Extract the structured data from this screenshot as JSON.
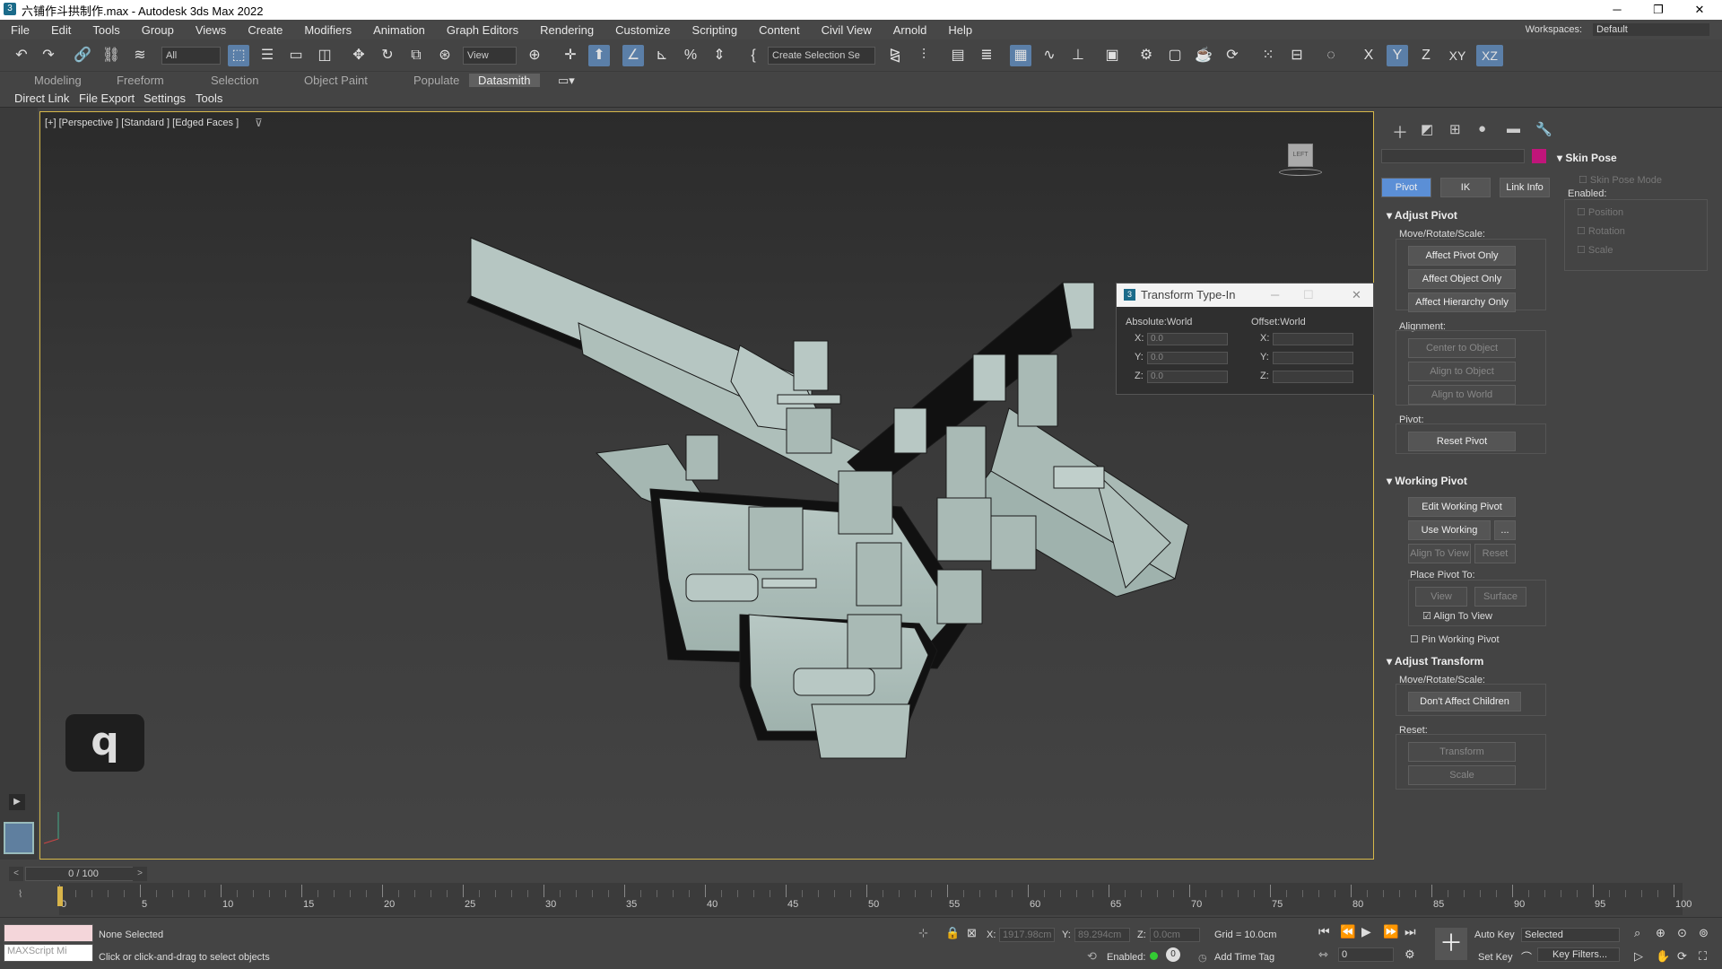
{
  "window": {
    "title": "六铺作斗拱制作.max - Autodesk 3ds Max 2022",
    "icon": "3ds-max-app-icon"
  },
  "menu": [
    "File",
    "Edit",
    "Tools",
    "Group",
    "Views",
    "Create",
    "Modifiers",
    "Animation",
    "Graph Editors",
    "Rendering",
    "Customize",
    "Scripting",
    "Content",
    "Civil View",
    "Arnold",
    "Help"
  ],
  "workspaces": {
    "label": "Workspaces:",
    "value": "Default"
  },
  "toolbar": {
    "filter": "All",
    "coord": "View",
    "selection_set": "Create Selection Se",
    "axis_labels": [
      "X",
      "Y",
      "Z",
      "XY",
      "XZ"
    ]
  },
  "ribbon": {
    "tabs": [
      "Modeling",
      "Freeform",
      "Selection",
      "Object Paint",
      "Populate",
      "Datasmith"
    ],
    "active": "Datasmith"
  },
  "subtoolbar": [
    "Direct Link",
    "File Export",
    "Settings",
    "Tools"
  ],
  "viewport": {
    "label": "[+] [Perspective ] [Standard ] [Edged Faces ]",
    "key_overlay": "q",
    "viewcube_label": "LEFT"
  },
  "transform_typein": {
    "title": "Transform Type-In",
    "absolute": "Absolute:World",
    "offset": "Offset:World",
    "abs_x": "0.0",
    "abs_y": "0.0",
    "abs_z": "0.0",
    "off_x": "",
    "off_y": "",
    "off_z": ""
  },
  "command_panel": {
    "tabs": [
      "Pivot",
      "IK",
      "Link Info"
    ],
    "adjust_pivot": {
      "header": "Adjust Pivot",
      "move_rotate_scale": "Move/Rotate/Scale:",
      "buttons": [
        "Affect Pivot Only",
        "Affect Object Only",
        "Affect Hierarchy Only"
      ],
      "alignment": "Alignment:",
      "align_buttons": [
        "Center to Object",
        "Align to Object",
        "Align to World"
      ],
      "pivot": "Pivot:",
      "reset_pivot": "Reset Pivot"
    },
    "working_pivot": {
      "header": "Working Pivot",
      "edit": "Edit Working Pivot",
      "use": "Use Working Pivot",
      "more": "...",
      "align_view": "Align To View",
      "reset": "Reset",
      "place_pivot_to": "Place Pivot To:",
      "view": "View",
      "surface": "Surface",
      "align_to_view_check": "Align To View",
      "pin": "Pin Working Pivot"
    },
    "adjust_transform": {
      "header": "Adjust Transform",
      "move_rotate_scale": "Move/Rotate/Scale:",
      "dont_affect": "Don't Affect Children",
      "reset": "Reset:",
      "transform": "Transform",
      "scale": "Scale"
    },
    "skin_pose": {
      "header": "Skin Pose",
      "mode": "Skin Pose Mode",
      "enabled": "Enabled:",
      "position": "Position",
      "rotation": "Rotation",
      "scale": "Scale"
    }
  },
  "timeline": {
    "frame": "0 / 100",
    "ticks": [
      "0",
      "5",
      "10",
      "15",
      "20",
      "25",
      "30",
      "35",
      "40",
      "45",
      "50",
      "55",
      "60",
      "65",
      "70",
      "75",
      "80",
      "85",
      "90",
      "95",
      "100"
    ]
  },
  "status": {
    "selection": "None Selected",
    "prompt": "Click or click-and-drag to select objects",
    "script_placeholder": "MAXScript Mi",
    "x_label": "X:",
    "x": "1917.98cm",
    "y_label": "Y:",
    "y": "89.294cm",
    "z_label": "Z:",
    "z": "0.0cm",
    "grid": "Grid = 10.0cm",
    "enabled": "Enabled:",
    "add_time_tag": "Add Time Tag",
    "auto_key": "Auto Key",
    "set_key": "Set Key",
    "selected": "Selected",
    "key_filters": "Key Filters...",
    "frame_field": "0"
  }
}
